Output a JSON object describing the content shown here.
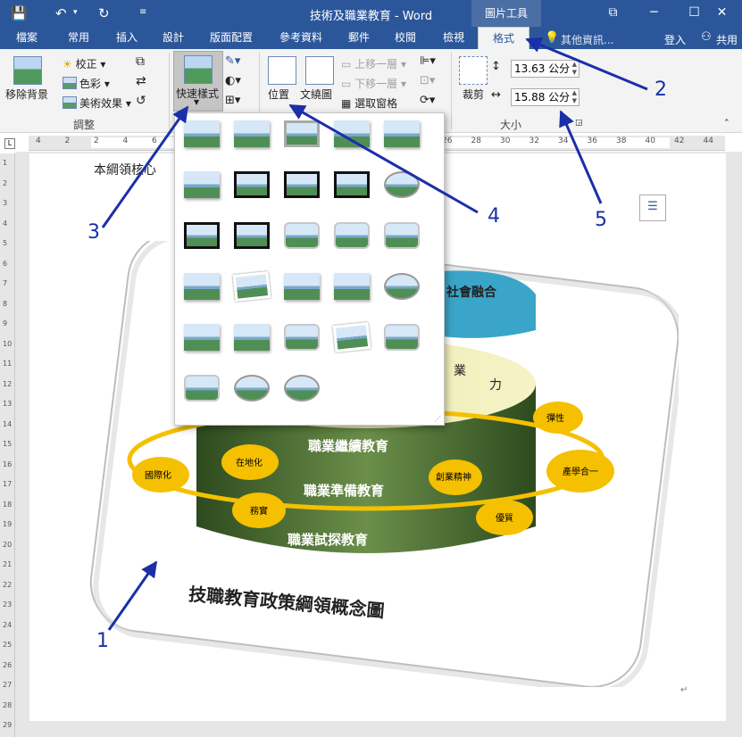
{
  "window": {
    "title": "技術及職業教育 - Word",
    "context_header": "圖片工具",
    "min": "─",
    "max": "☐",
    "close": "✕",
    "restore": "⧉"
  },
  "tabs": [
    {
      "label": "檔案"
    },
    {
      "label": "常用"
    },
    {
      "label": "插入"
    },
    {
      "label": "設計"
    },
    {
      "label": "版面配置"
    },
    {
      "label": "參考資料"
    },
    {
      "label": "郵件"
    },
    {
      "label": "校閱"
    },
    {
      "label": "檢視"
    },
    {
      "label": "格式",
      "active": true
    }
  ],
  "tell_me": "其他資訊...",
  "sign_in": "登入",
  "share": "共用",
  "ribbon": {
    "remove_bg": "移除背景",
    "corrections": "校正",
    "color": "色彩",
    "art_effects": "美術效果",
    "adjust_group": "調整",
    "quick_styles": "快速樣式",
    "position": "位置",
    "wrap_text": "文繞圖",
    "bring_forward": "上移一層",
    "send_backward": "下移一層",
    "selection_pane": "選取窗格",
    "crop": "裁剪",
    "size_group": "大小",
    "height": "13.63 公分",
    "width": "15.88 公分"
  },
  "document": {
    "text": "本綱領核心"
  },
  "diagram": {
    "title": "技職教育政策綱領概念圖",
    "layer1": "職業繼續教育",
    "layer2": "職業準備教育",
    "layer3": "職業試探教育",
    "top_left": "業",
    "top_right": "力",
    "pie_label": "社會融合",
    "ellipses": [
      "彈性",
      "產學合一",
      "創業精神",
      "優質",
      "在地化",
      "國際化",
      "務實"
    ]
  },
  "annotations": [
    "1",
    "2",
    "3",
    "4",
    "5"
  ],
  "ruler_numbers": [
    "4",
    "2",
    "2",
    "4",
    "6",
    "8",
    "10",
    "12",
    "14",
    "16",
    "18",
    "20",
    "22",
    "24",
    "26",
    "28",
    "30",
    "32",
    "34",
    "36",
    "38",
    "40",
    "42",
    "44"
  ],
  "vruler_numbers": [
    "1",
    "2",
    "3",
    "4",
    "5",
    "6",
    "7",
    "8",
    "9",
    "10",
    "11",
    "12",
    "13",
    "14",
    "15",
    "16",
    "17",
    "18",
    "19",
    "20",
    "21",
    "22",
    "23",
    "24",
    "25",
    "26",
    "27",
    "28",
    "29"
  ],
  "colors": {
    "titlebar": "#2b579a",
    "annotation": "#1b2fa8",
    "ellipse": "#f5c000",
    "cylinder": "#3d5e2a"
  }
}
